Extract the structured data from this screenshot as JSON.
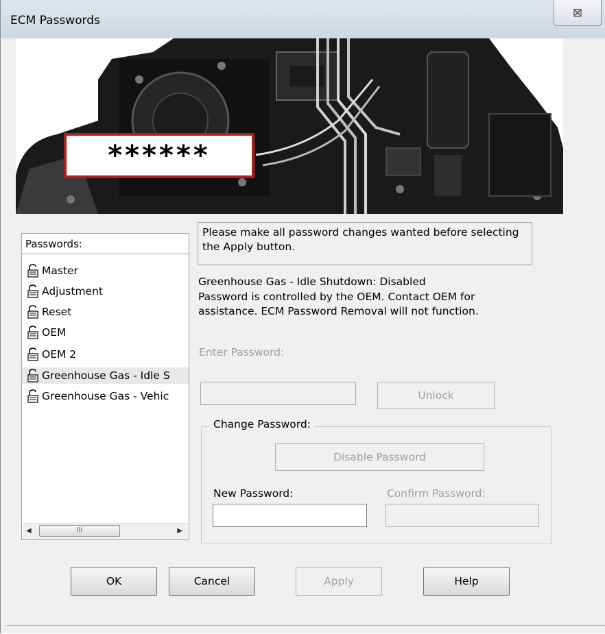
{
  "window": {
    "title": "ECM Passwords",
    "close_label": "⊠"
  },
  "banner": {
    "masked_password": "******"
  },
  "passwords_list": {
    "header": "Passwords:",
    "items": [
      {
        "label": "Master"
      },
      {
        "label": "Adjustment"
      },
      {
        "label": "Reset"
      },
      {
        "label": "OEM"
      },
      {
        "label": "OEM 2"
      },
      {
        "label": "Greenhouse Gas - Idle S"
      },
      {
        "label": "Greenhouse Gas - Vehic"
      }
    ],
    "scroll_thumb_label": "III"
  },
  "info": {
    "message": "Please make all password changes wanted before selecting the Apply button.",
    "status_line1": "Greenhouse Gas - Idle Shutdown:  Disabled",
    "status_line2": "Password is controlled by the OEM. Contact OEM for",
    "status_line3": "assistance. ECM Password Removal will not function."
  },
  "enter_password": {
    "label": "Enter Password:",
    "value": "",
    "unlock_label": "Unlock"
  },
  "change_password": {
    "legend": "Change Password:",
    "disable_label": "Disable Password",
    "new_label": "New Password:",
    "confirm_label": "Confirm Password:",
    "new_value": "",
    "confirm_value": ""
  },
  "buttons": {
    "ok": "OK",
    "cancel": "Cancel",
    "apply": "Apply",
    "help": "Help"
  }
}
